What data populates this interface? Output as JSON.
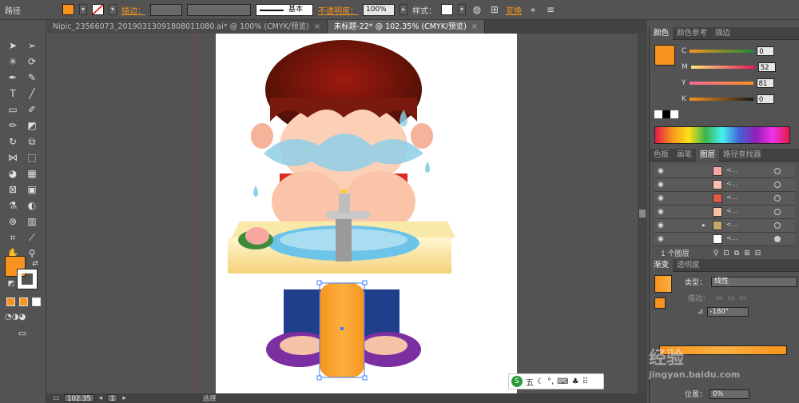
{
  "control_bar": {
    "mode_label": "路径",
    "fill_color": "#f7931e",
    "stroke_label": "描边：",
    "stroke_profile": "基本",
    "opacity_label": "不透明度：",
    "opacity_value": "100%",
    "style_label": "样式：",
    "transform_label": "变换"
  },
  "tabs": [
    {
      "label": "Nipic_23566073_20190313091808011080.ai* @ 100% (CMYK/预览)",
      "close": "×"
    },
    {
      "label": "未标题-22* @ 102.35% (CMYK/预览)",
      "close": "×"
    }
  ],
  "status": {
    "zoom": "102.35",
    "artboard": "1",
    "tool": "选择"
  },
  "color_panel": {
    "tabs": [
      "颜色",
      "颜色参考",
      "描边"
    ],
    "channels": [
      {
        "name": "C",
        "value": "0"
      },
      {
        "name": "M",
        "value": "52"
      },
      {
        "name": "Y",
        "value": "81"
      },
      {
        "name": "K",
        "value": "0"
      }
    ],
    "current_color": "#f7931e"
  },
  "layers_panel": {
    "tabs": [
      "色板",
      "画笔",
      "图层",
      "路径查找器"
    ],
    "rows": [
      {
        "name": "<..."
      },
      {
        "name": "<..."
      },
      {
        "name": "<..."
      },
      {
        "name": "<..."
      },
      {
        "name": "<..."
      },
      {
        "name": "<..."
      }
    ],
    "footer": "1 个图层"
  },
  "gradient_panel": {
    "tabs": [
      "渐变",
      "透明度"
    ],
    "type_label": "类型：",
    "type_value": "线性",
    "stroke_label": "描边：",
    "angle_value": "-180°",
    "position_label": "位置：",
    "position_value": "0%"
  },
  "watermark": "经验",
  "watermark_url": "jingyan.baidu.com",
  "ime": {
    "label": "五"
  }
}
